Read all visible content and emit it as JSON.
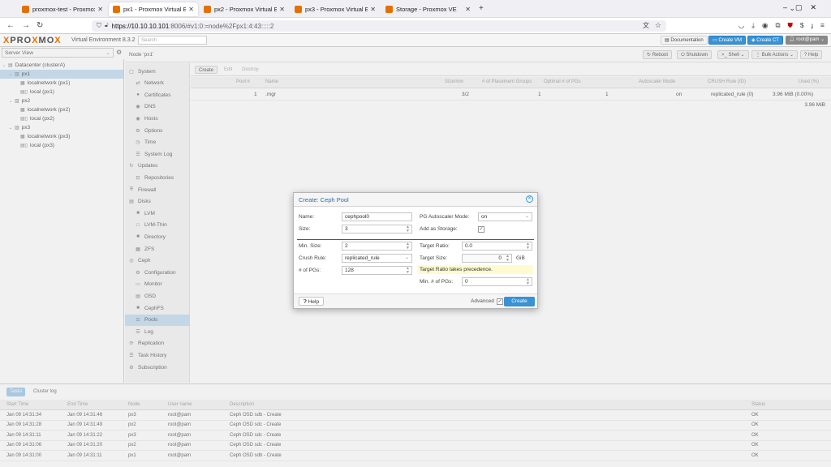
{
  "browser": {
    "tabs": [
      {
        "title": "proxmox-test - Proxmox Vi",
        "active": false
      },
      {
        "title": "px1 - Proxmox Virtual Envi",
        "active": true
      },
      {
        "title": "px2 - Proxmox Virtual Envi",
        "active": false
      },
      {
        "title": "px3 - Proxmox Virtual Envi",
        "active": false
      },
      {
        "title": "Storage - Proxmox VE",
        "active": false
      }
    ],
    "url_host": "https://10.10.10.101",
    "url_path": ":8006/#v1:0:=node%2Fpx1:4:43:::::2"
  },
  "header": {
    "logo_a": "PRO",
    "logo_x": "X",
    "logo_b": "MO",
    "logo_x2": "X",
    "version": "Virtual Environment 8.3.2",
    "search_placeholder": "Search",
    "documentation": "Documentation",
    "create_vm": "Create VM",
    "create_ct": "Create CT",
    "user": "root@pam"
  },
  "tree": {
    "view": "Server View",
    "items": [
      {
        "label": "Datacenter (clusterA)",
        "level": 0
      },
      {
        "label": "px1",
        "level": 1,
        "selected": true
      },
      {
        "label": "localnetwork (px1)",
        "level": 2
      },
      {
        "label": "local (px1)",
        "level": 2
      },
      {
        "label": "px2",
        "level": 1
      },
      {
        "label": "localnetwork (px2)",
        "level": 2
      },
      {
        "label": "local (px2)",
        "level": 2
      },
      {
        "label": "px3",
        "level": 1
      },
      {
        "label": "localnetwork (px3)",
        "level": 2
      },
      {
        "label": "local (px3)",
        "level": 2
      }
    ]
  },
  "node": {
    "title": "Node 'px1'",
    "reboot": "Reboot",
    "shutdown": "Shutdown",
    "shell": "Shell",
    "bulk": "Bulk Actions",
    "help": "Help"
  },
  "submenu": [
    {
      "label": "System",
      "lvl": 0,
      "icon": "▢"
    },
    {
      "label": "Network",
      "lvl": 1,
      "icon": "⇄"
    },
    {
      "label": "Certificates",
      "lvl": 1,
      "icon": "●"
    },
    {
      "label": "DNS",
      "lvl": 1,
      "icon": "◉"
    },
    {
      "label": "Hosts",
      "lvl": 1,
      "icon": "◉"
    },
    {
      "label": "Options",
      "lvl": 1,
      "icon": "⚙"
    },
    {
      "label": "Time",
      "lvl": 1,
      "icon": "◷"
    },
    {
      "label": "System Log",
      "lvl": 1,
      "icon": "☰"
    },
    {
      "label": "Updates",
      "lvl": 0,
      "icon": "↻"
    },
    {
      "label": "Repositories",
      "lvl": 1,
      "icon": "⊡"
    },
    {
      "label": "Firewall",
      "lvl": 0,
      "icon": "⛨"
    },
    {
      "label": "Disks",
      "lvl": 0,
      "icon": "▤"
    },
    {
      "label": "LVM",
      "lvl": 1,
      "icon": "■"
    },
    {
      "label": "LVM-Thin",
      "lvl": 1,
      "icon": "□"
    },
    {
      "label": "Directory",
      "lvl": 1,
      "icon": "■"
    },
    {
      "label": "ZFS",
      "lvl": 1,
      "icon": "▦"
    },
    {
      "label": "Ceph",
      "lvl": 0,
      "icon": "◎"
    },
    {
      "label": "Configuration",
      "lvl": 1,
      "icon": "⚙"
    },
    {
      "label": "Monitor",
      "lvl": 1,
      "icon": "▭"
    },
    {
      "label": "OSD",
      "lvl": 1,
      "icon": "▤"
    },
    {
      "label": "CephFS",
      "lvl": 1,
      "icon": "■"
    },
    {
      "label": "Pools",
      "lvl": 1,
      "icon": "⚖",
      "selected": true
    },
    {
      "label": "Log",
      "lvl": 1,
      "icon": "☰"
    },
    {
      "label": "Replication",
      "lvl": 0,
      "icon": "⟳"
    },
    {
      "label": "Task History",
      "lvl": 0,
      "icon": "☰"
    },
    {
      "label": "Subscription",
      "lvl": 0,
      "icon": "⚙"
    }
  ],
  "pools": {
    "toolbar": {
      "create": "Create",
      "edit": "Edit",
      "destroy": "Destroy"
    },
    "columns": [
      "Pool #",
      "Name",
      "Size/min",
      "# of Placement Groups",
      "Optimal # of PGs",
      "Autoscaler Mode",
      "CRUSH Rule (ID)",
      "Used (%)"
    ],
    "rows": [
      {
        "num": "1",
        "name": ".mgr",
        "size": "3/2",
        "pgs": "1",
        "optimal": "1",
        "mode": "on",
        "rule": "replicated_rule (0)",
        "used": "3.96 MiB (0.00%)"
      }
    ],
    "total": "3.96 MiB"
  },
  "dialog": {
    "title": "Create: Ceph Pool",
    "name_label": "Name:",
    "name_value": "cephpool0",
    "size_label": "Size:",
    "size_value": "3",
    "minsize_label": "Min. Size:",
    "minsize_value": "2",
    "crush_label": "Crush Rule:",
    "crush_value": "replicated_rule",
    "pgs_label": "# of PGs:",
    "pgs_value": "128",
    "autoscale_label": "PG Autoscaler Mode:",
    "autoscale_value": "on",
    "storage_label": "Add as Storage:",
    "ratio_label": "Target Ratio:",
    "ratio_value": "0.0",
    "tsize_label": "Target Size:",
    "tsize_value": "0",
    "tsize_unit": "GiB",
    "hint": "Target Ratio takes precedence.",
    "minpg_label": "Min. # of PGs:",
    "minpg_value": "0",
    "help": "Help",
    "advanced": "Advanced",
    "create": "Create"
  },
  "log": {
    "tabs": [
      "Tasks",
      "Cluster log"
    ],
    "columns": [
      "Start Time",
      "End Time",
      "Node",
      "User name",
      "Description",
      "Status"
    ],
    "rows": [
      {
        "start": "Jan 09 14:31:34",
        "end": "Jan 09 14:31:46",
        "node": "px3",
        "user": "root@pam",
        "desc": "Ceph OSD sdb - Create",
        "status": "OK"
      },
      {
        "start": "Jan 09 14:31:28",
        "end": "Jan 09 14:31:49",
        "node": "px2",
        "user": "root@pam",
        "desc": "Ceph OSD sdc - Create",
        "status": "OK"
      },
      {
        "start": "Jan 09 14:31:11",
        "end": "Jan 09 14:31:22",
        "node": "px3",
        "user": "root@pam",
        "desc": "Ceph OSD sdc - Create",
        "status": "OK"
      },
      {
        "start": "Jan 09 14:31:06",
        "end": "Jan 09 14:31:20",
        "node": "px2",
        "user": "root@pam",
        "desc": "Ceph OSD sdc - Create",
        "status": "OK"
      },
      {
        "start": "Jan 09 14:31:00",
        "end": "Jan 09 14:31:11",
        "node": "px1",
        "user": "root@pam",
        "desc": "Ceph OSD sdb - Create",
        "status": "OK"
      }
    ]
  }
}
